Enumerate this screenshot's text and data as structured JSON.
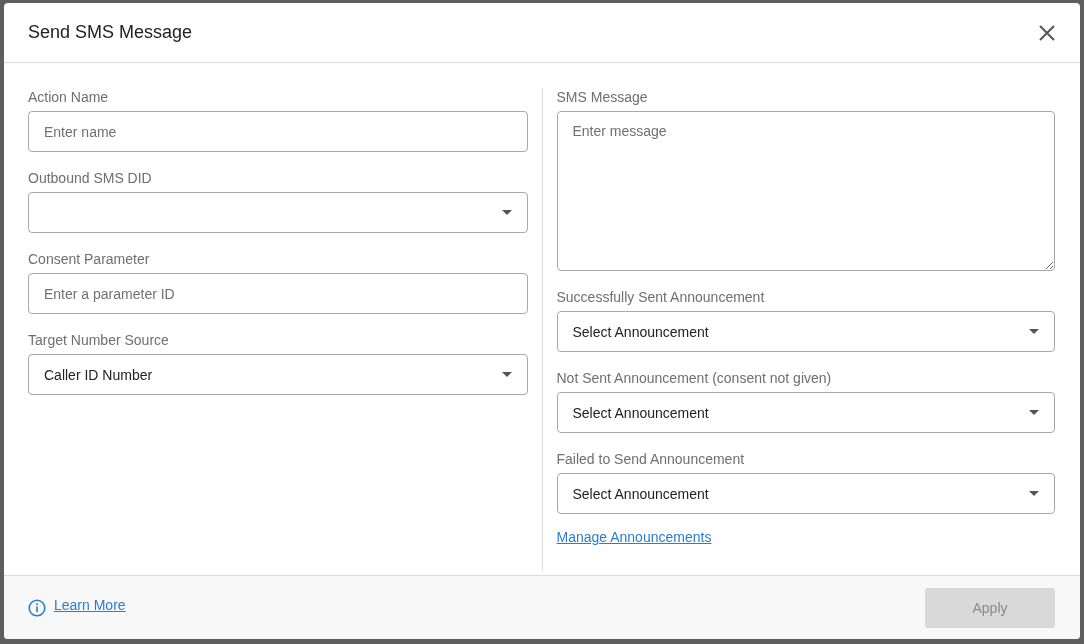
{
  "dialog": {
    "title": "Send SMS Message"
  },
  "left_fields": [
    {
      "kind": "text",
      "label": "Action Name",
      "placeholder": "Enter name"
    },
    {
      "kind": "select",
      "label": "Outbound SMS DID"
    },
    {
      "kind": "text",
      "label": "Consent Parameter",
      "placeholder": "Enter a parameter ID"
    },
    {
      "kind": "select",
      "label": "Target Number Source",
      "value": "Caller ID Number"
    }
  ],
  "right_fields": [
    {
      "kind": "textarea",
      "label": "SMS Message",
      "placeholder": "Enter message"
    },
    {
      "kind": "select",
      "label": "Successfully Sent Announcement",
      "value": "Select Announcement"
    },
    {
      "kind": "select",
      "label": "Not Sent Announcement (consent not given)",
      "value": "Select Announcement"
    },
    {
      "kind": "select",
      "label": "Failed to Send Announcement",
      "value": "Select Announcement"
    }
  ],
  "manage_link": "Manage Announcements",
  "footer": {
    "learn_more": "Learn More",
    "apply": {
      "label": "Apply",
      "disabled": true
    }
  }
}
